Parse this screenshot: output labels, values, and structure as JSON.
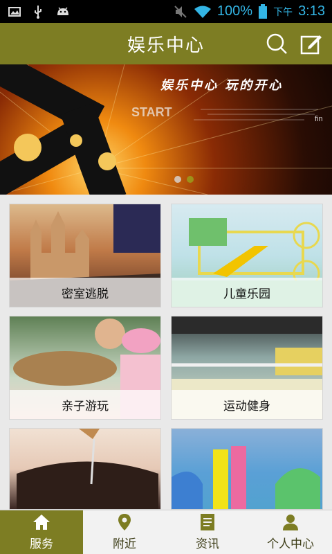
{
  "status_bar": {
    "battery": "100%",
    "period": "下午",
    "time": "3:13"
  },
  "header": {
    "title": "娱乐中心"
  },
  "banner": {
    "slogan": "娱乐中心  玩的开心"
  },
  "categories": [
    {
      "label": "密室逃脱",
      "icon": "castle"
    },
    {
      "label": "儿童乐园",
      "icon": "playground"
    },
    {
      "label": "亲子游玩",
      "icon": "family"
    },
    {
      "label": "运动健身",
      "icon": "gym"
    },
    {
      "label": "",
      "icon": "spa"
    },
    {
      "label": "",
      "icon": "waterpark"
    }
  ],
  "bottom_nav": [
    {
      "label": "服务",
      "icon": "home-icon",
      "active": true
    },
    {
      "label": "附近",
      "icon": "location-pin-icon",
      "active": false
    },
    {
      "label": "资讯",
      "icon": "news-icon",
      "active": false
    },
    {
      "label": "个人中心",
      "icon": "person-icon",
      "active": false
    }
  ],
  "colors": {
    "accent": "#7d7d23",
    "status_blue": "#33b5e5"
  }
}
